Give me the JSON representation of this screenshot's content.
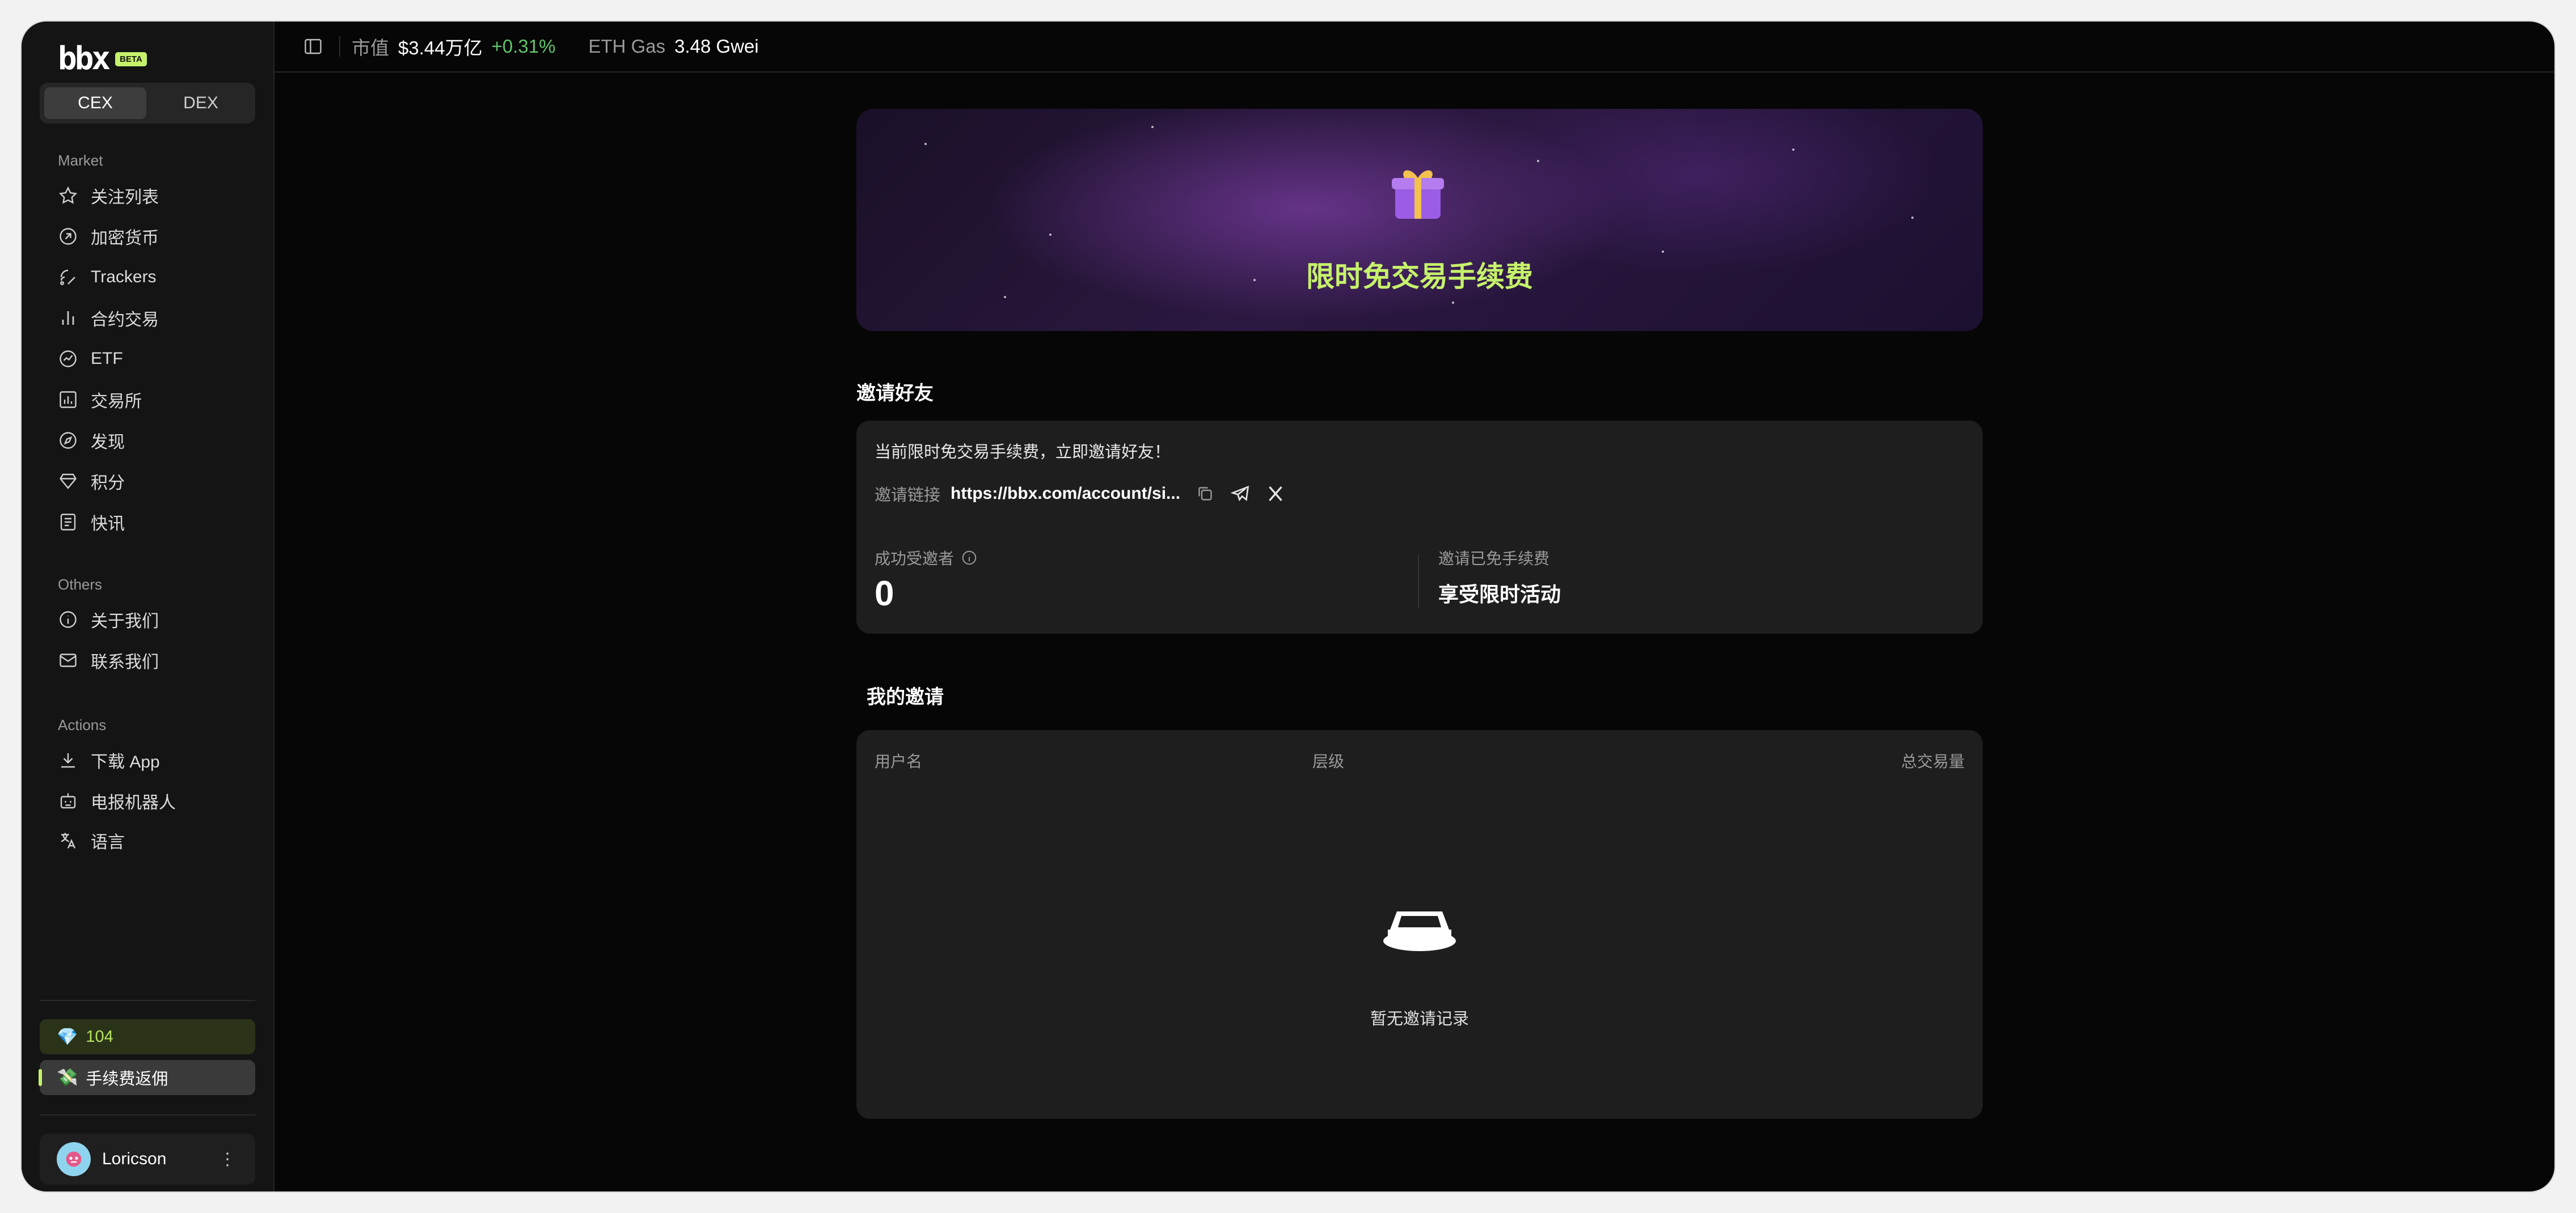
{
  "brand": {
    "logo": "bbx",
    "badge": "BETA"
  },
  "mode_switch": {
    "cex": "CEX",
    "dex": "DEX"
  },
  "sidebar": {
    "market_title": "Market",
    "market_items": [
      {
        "label": "关注列表",
        "icon": "star-icon"
      },
      {
        "label": "加密货币",
        "icon": "coin-icon"
      },
      {
        "label": "Trackers",
        "icon": "signal-icon"
      },
      {
        "label": "合约交易",
        "icon": "bar-chart-icon"
      },
      {
        "label": "ETF",
        "icon": "trend-icon"
      },
      {
        "label": "交易所",
        "icon": "exchange-icon"
      },
      {
        "label": "发现",
        "icon": "compass-icon"
      },
      {
        "label": "积分",
        "icon": "diamond-icon"
      },
      {
        "label": "快讯",
        "icon": "news-icon"
      }
    ],
    "others_title": "Others",
    "others_items": [
      {
        "label": "关于我们",
        "icon": "info-icon"
      },
      {
        "label": "联系我们",
        "icon": "mail-icon"
      }
    ],
    "actions_title": "Actions",
    "actions_items": [
      {
        "label": "下载 App",
        "icon": "download-icon"
      },
      {
        "label": "电报机器人",
        "icon": "bot-icon"
      },
      {
        "label": "语言",
        "icon": "translate-icon"
      }
    ],
    "points": "104",
    "rebate": "手续费返佣",
    "user": "Loricson"
  },
  "topbar": {
    "market_cap_label": "市值",
    "market_cap_value": "$3.44万亿",
    "market_cap_change": "+0.31%",
    "gas_label": "ETH Gas",
    "gas_value": "3.48 Gwei"
  },
  "banner": {
    "title": "限时免交易手续费"
  },
  "invite": {
    "heading": "邀请好友",
    "promo": "当前限时免交易手续费，立即邀请好友！",
    "link_label": "邀请链接",
    "link_value": "https://bbx.com/account/si...",
    "success_label": "成功受邀者",
    "success_value": "0",
    "fee_label": "邀请已免手续费",
    "fee_value": "享受限时活动"
  },
  "my_invites": {
    "heading": "我的邀请",
    "columns": [
      "用户名",
      "层级",
      "总交易量"
    ],
    "empty": "暂无邀请记录"
  },
  "colors": {
    "accent": "#c6f26b",
    "positive": "#5fc46a",
    "bg": "#060606",
    "card": "#1e1e1e"
  }
}
